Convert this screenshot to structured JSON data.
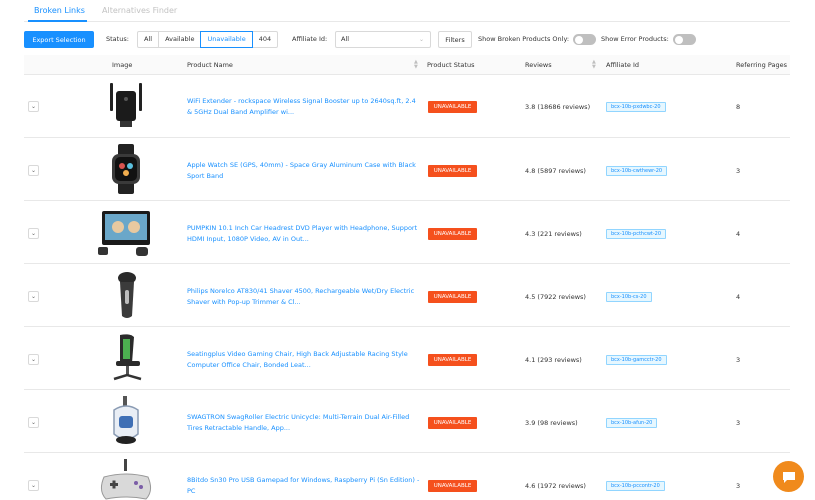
{
  "tabs": [
    {
      "label": "Broken Links",
      "active": true
    },
    {
      "label": "Alternatives Finder",
      "active": false
    }
  ],
  "toolbar": {
    "export_label": "Export Selection",
    "status_label": "Status:",
    "status_options": [
      "All",
      "Available",
      "Unavailable",
      "404"
    ],
    "status_selected": "Unavailable",
    "affiliate_label": "Affiliate Id:",
    "affiliate_value": "All",
    "filters_label": "Filters",
    "broken_only_label": "Show Broken Products Only:",
    "broken_only_on": false,
    "error_products_label": "Show Error Products:",
    "error_products_on": false
  },
  "table": {
    "headers": {
      "image": "Image",
      "product_name": "Product Name",
      "product_status": "Product Status",
      "reviews": "Reviews",
      "affiliate_id": "Affiliate Id",
      "referring_pages": "Referring Pages"
    },
    "rows": [
      {
        "name": "WiFi Extender - rockspace Wireless Signal Booster up to 2640sq.ft, 2.4 & 5GHz Dual Band Amplifier wi...",
        "status": "UNAVAILABLE",
        "reviews": "3.8 (18686 reviews)",
        "affiliate": "bcx-10b-pxdwbc-20",
        "pages": "8",
        "image_icon": "wifi-extender-icon"
      },
      {
        "name": "Apple Watch SE (GPS, 40mm) - Space Gray Aluminum Case with Black Sport Band",
        "status": "UNAVAILABLE",
        "reviews": "4.8 (5897 reviews)",
        "affiliate": "bcx-10b-cwthewr-20",
        "pages": "3",
        "image_icon": "smartwatch-icon"
      },
      {
        "name": "PUMPKIN 10.1 Inch Car Headrest DVD Player with Headphone, Support HDMI Input, 1080P Video, AV in Out...",
        "status": "UNAVAILABLE",
        "reviews": "4.3 (221 reviews)",
        "affiliate": "bcx-10b-pcthcwt-20",
        "pages": "4",
        "image_icon": "dvd-player-icon"
      },
      {
        "name": "Philips Norelco AT830/41 Shaver 4500, Rechargeable Wet/Dry Electric Shaver with Pop-up Trimmer & Cl...",
        "status": "UNAVAILABLE",
        "reviews": "4.5 (7922 reviews)",
        "affiliate": "bcx-10b-cs-20",
        "pages": "4",
        "image_icon": "shaver-icon"
      },
      {
        "name": "Seatingplus Video Gaming Chair, High Back Adjustable Racing Style Computer Office Chair, Bonded Leat...",
        "status": "UNAVAILABLE",
        "reviews": "4.1 (293 reviews)",
        "affiliate": "bcx-10b-gamcctr-20",
        "pages": "3",
        "image_icon": "gaming-chair-icon"
      },
      {
        "name": "SWAGTRON SwagRoller Electric Unicycle: Multi-Terrain Dual Air-Filled Tires Retractable Handle, App...",
        "status": "UNAVAILABLE",
        "reviews": "3.9 (98 reviews)",
        "affiliate": "bcx-10b-afun-20",
        "pages": "3",
        "image_icon": "unicycle-icon"
      },
      {
        "name": "8Bitdo Sn30 Pro USB Gamepad for Windows, Raspberry Pi (Sn Edition) - PC",
        "status": "UNAVAILABLE",
        "reviews": "4.6 (1972 reviews)",
        "affiliate": "bcx-10b-pccontr-20",
        "pages": "3",
        "image_icon": "gamepad-icon"
      }
    ]
  },
  "colors": {
    "accent": "#1890ff",
    "unavailable_badge": "#f5501d",
    "chat_button": "#f08a1c"
  }
}
